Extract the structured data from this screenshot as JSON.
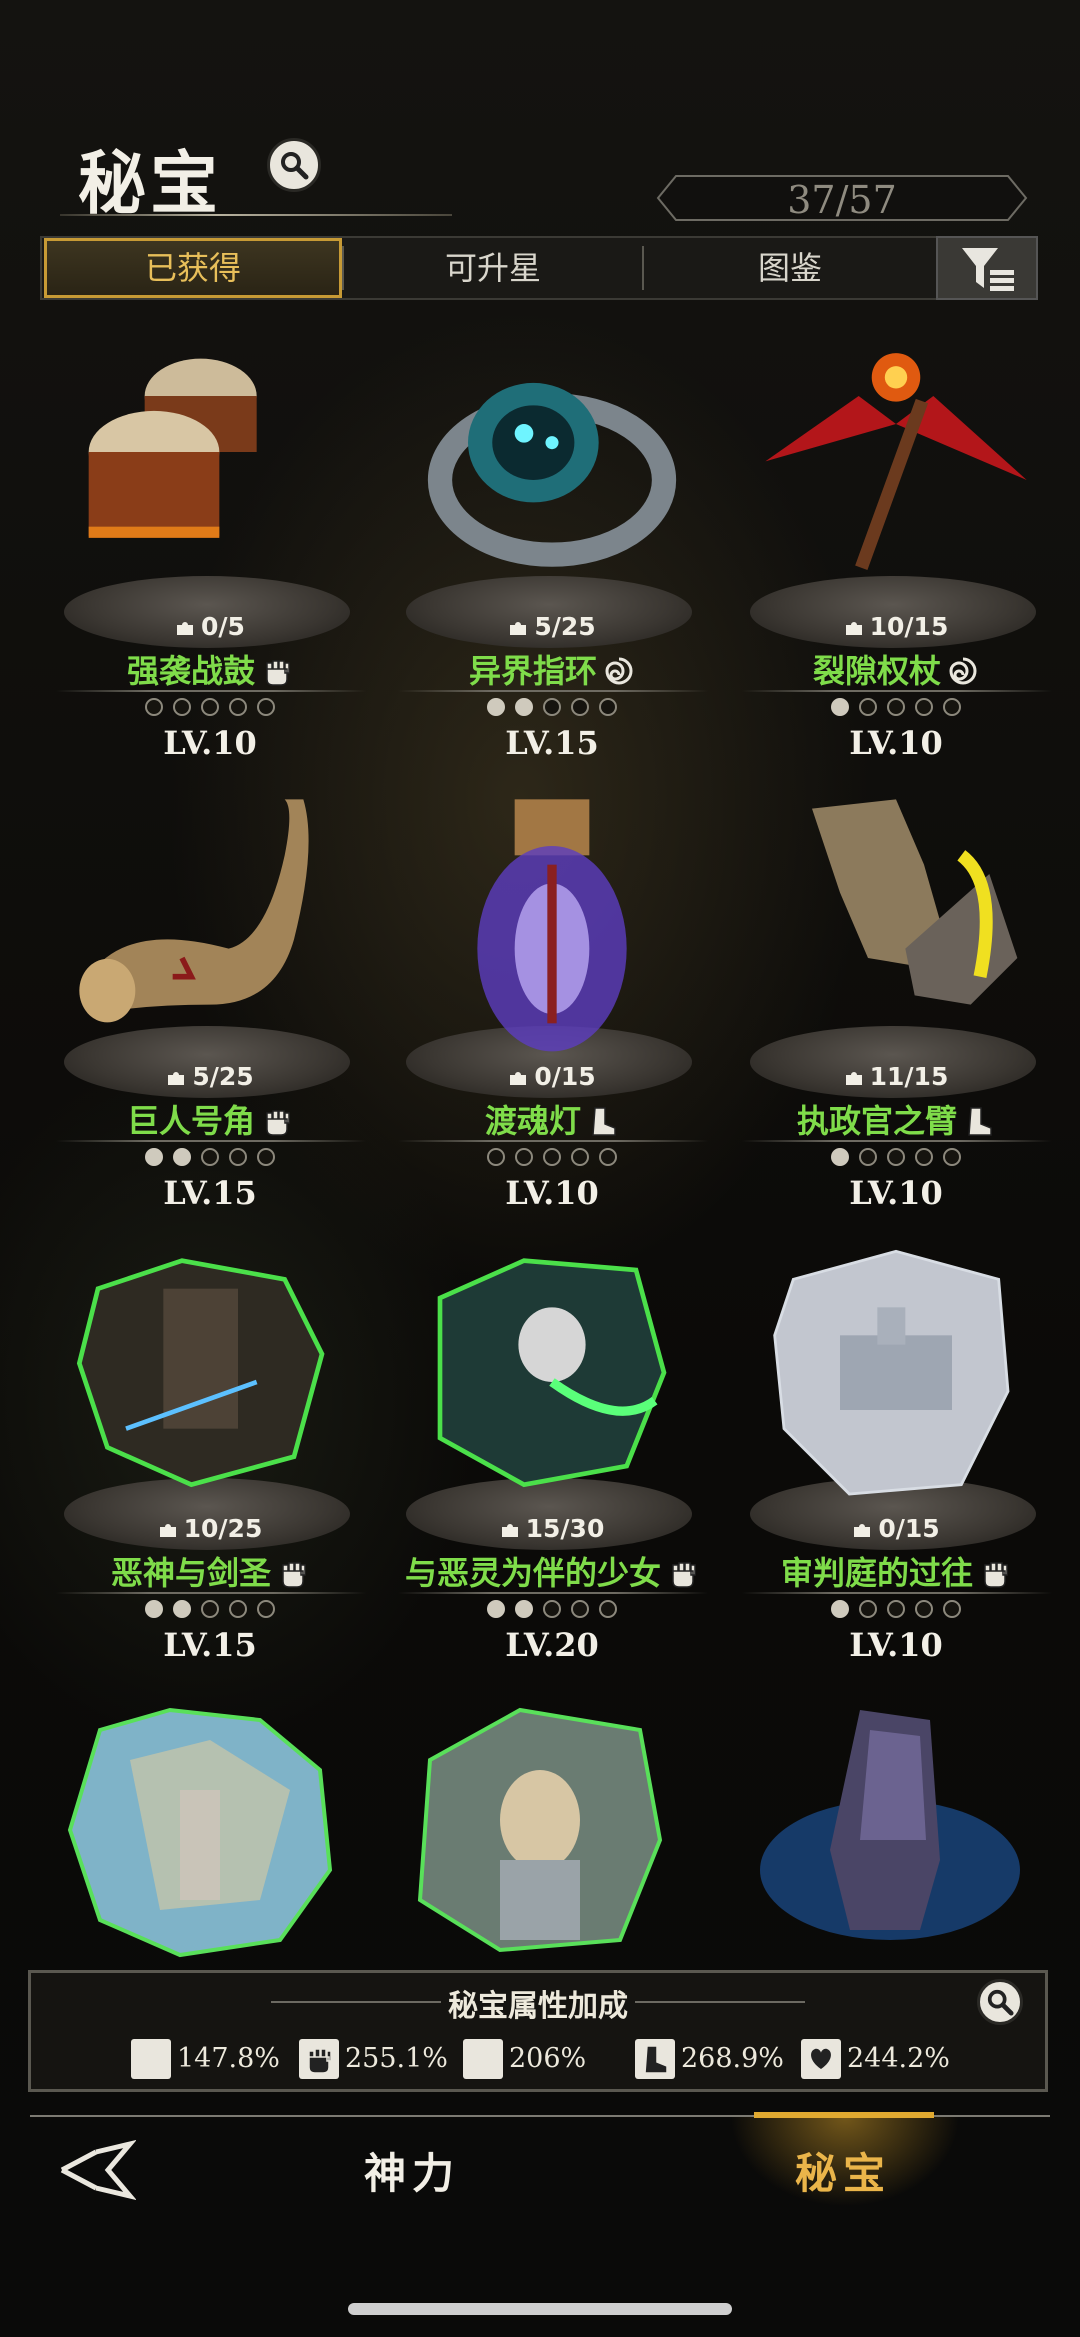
{
  "header": {
    "title": "秘宝",
    "counter": "37/57"
  },
  "tabs": [
    {
      "label": "已获得",
      "active": true
    },
    {
      "label": "可升星",
      "active": false
    },
    {
      "label": "图鉴",
      "active": false
    }
  ],
  "items": [
    {
      "count": "0/5",
      "name": "强袭战鼓",
      "tag_icon": "fist-icon",
      "stars": 0,
      "level": "LV.10",
      "art": "war-drums"
    },
    {
      "count": "5/25",
      "name": "异界指环",
      "tag_icon": "swirl-icon",
      "stars": 2,
      "level": "LV.15",
      "art": "otherworld-ring"
    },
    {
      "count": "10/15",
      "name": "裂隙权杖",
      "tag_icon": "swirl-icon",
      "stars": 1,
      "level": "LV.10",
      "art": "rift-scepter"
    },
    {
      "count": "5/25",
      "name": "巨人号角",
      "tag_icon": "fist-icon",
      "stars": 2,
      "level": "LV.15",
      "art": "giant-horn"
    },
    {
      "count": "0/15",
      "name": "渡魂灯",
      "tag_icon": "boot-icon",
      "stars": 0,
      "level": "LV.10",
      "art": "soul-lantern"
    },
    {
      "count": "11/15",
      "name": "执政官之臂",
      "tag_icon": "boot-icon",
      "stars": 1,
      "level": "LV.10",
      "art": "archon-arm"
    },
    {
      "count": "10/25",
      "name": "恶神与剑圣",
      "tag_icon": "fist-icon",
      "stars": 2,
      "level": "LV.15",
      "art": "demon-and-swordmaster"
    },
    {
      "count": "15/30",
      "name": "与恶灵为伴的少女",
      "tag_icon": "fist-icon",
      "stars": 2,
      "level": "LV.20",
      "art": "girl-with-spirits"
    },
    {
      "count": "0/15",
      "name": "审判庭的过往",
      "tag_icon": "fist-icon",
      "stars": 1,
      "level": "LV.10",
      "art": "tribunal-past"
    }
  ],
  "bonus": {
    "title": "秘宝属性加成",
    "stats": [
      {
        "icon": "swords-icon",
        "value": "147.8%"
      },
      {
        "icon": "fist-icon",
        "value": "255.1%"
      },
      {
        "icon": "swirl-icon",
        "value": "206%"
      },
      {
        "icon": "boot-icon",
        "value": "268.9%"
      },
      {
        "icon": "heart-hand-icon",
        "value": "244.2%"
      }
    ]
  },
  "nav": {
    "divine": "神力",
    "treasure": "秘宝",
    "active": "秘宝"
  },
  "colors": {
    "accent_gold": "#e0a930",
    "name_green": "#7fdc4a",
    "bg": "#0c0c0a"
  }
}
